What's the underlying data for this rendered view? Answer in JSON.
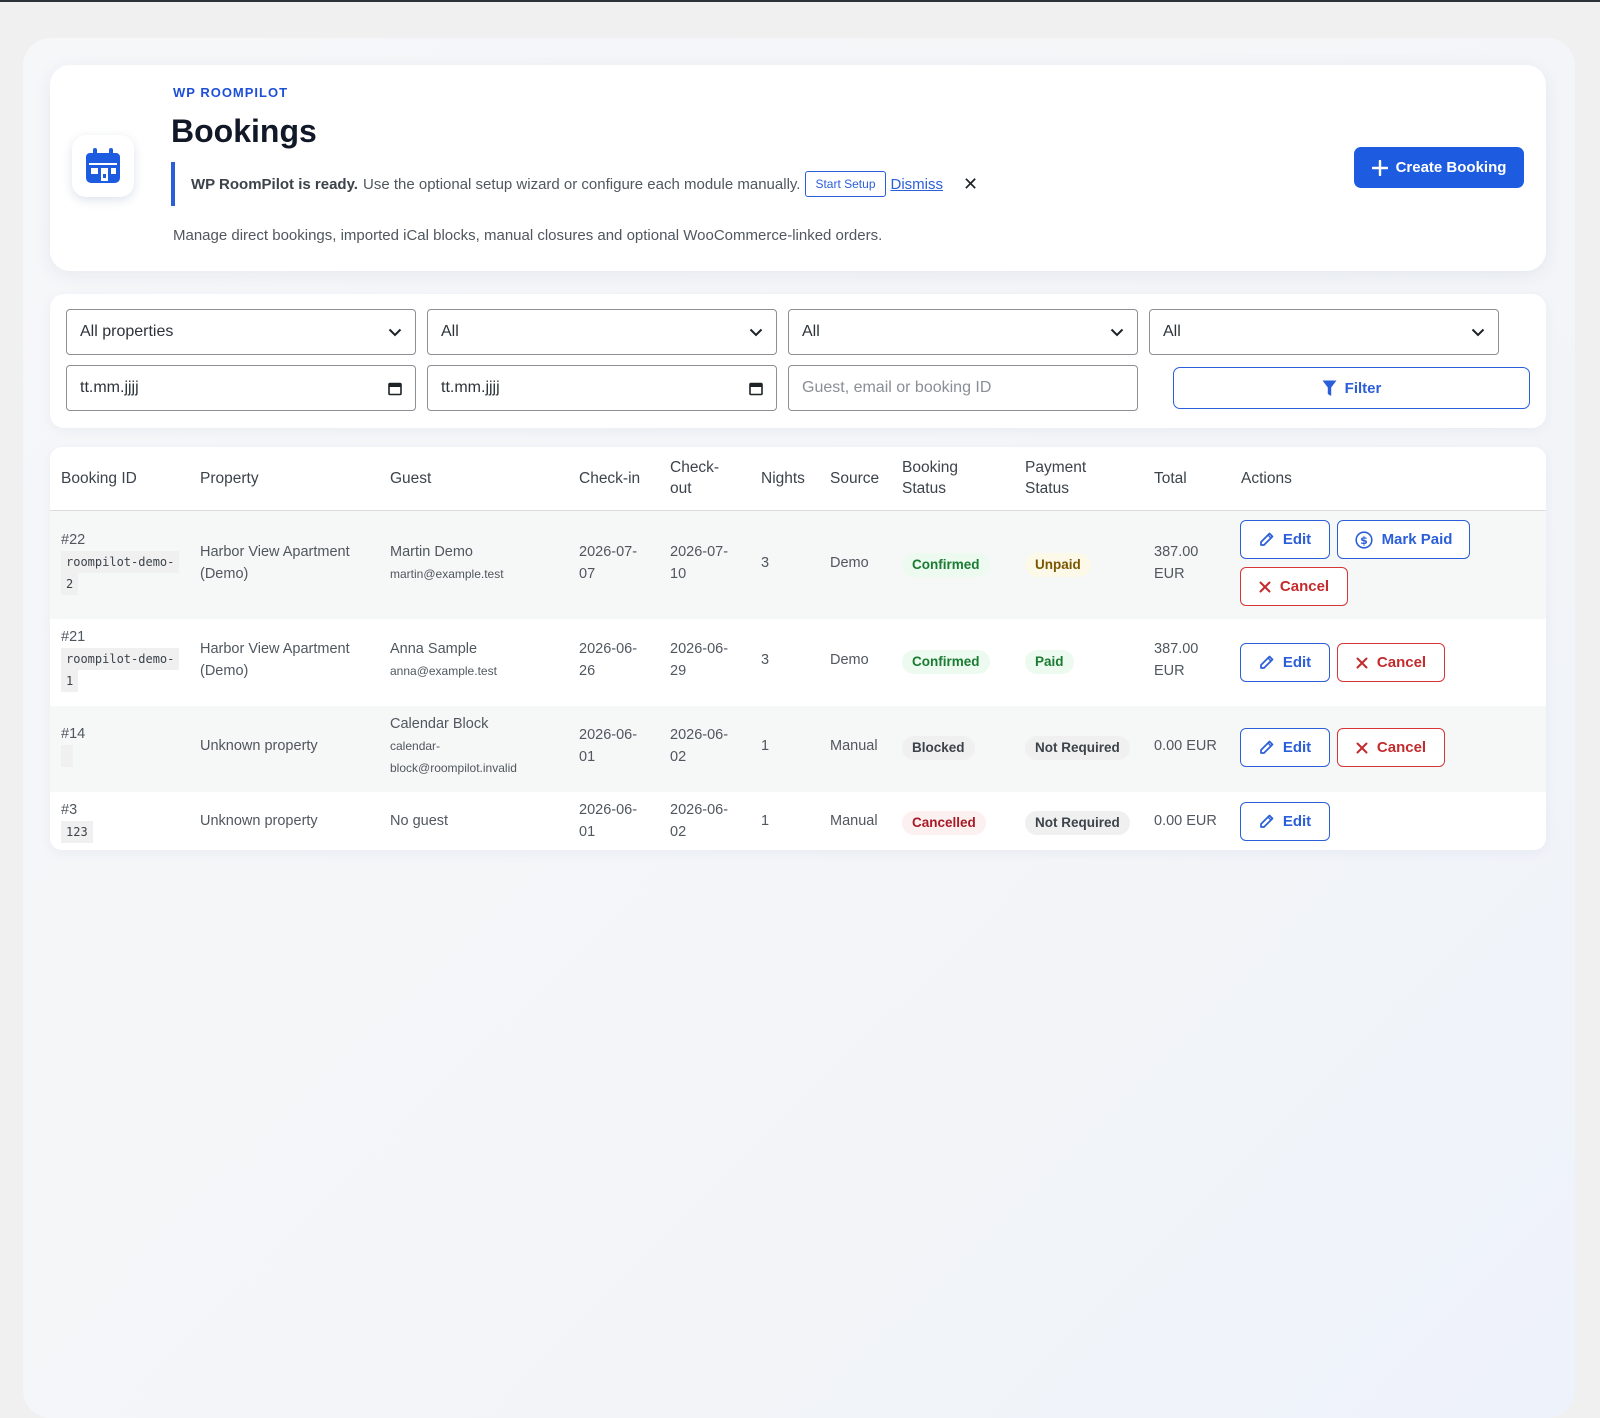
{
  "header": {
    "eyebrow": "WP ROOMPILOT",
    "title": "Bookings",
    "notice_bold": "WP RoomPilot is ready.",
    "notice_text": "Use the optional setup wizard or configure each module manually.",
    "start_setup_label": "Start Setup",
    "dismiss_label": "Dismiss",
    "close_glyph": "✕",
    "subtitle": "Manage direct bookings, imported iCal blocks, manual closures and optional WooCommerce-linked orders.",
    "create_label": "Create Booking"
  },
  "filters": {
    "property_select": "All properties",
    "select_2": "All",
    "select_3": "All",
    "select_4": "All",
    "date_from": "tt.mm.jjjj",
    "date_to": "tt.mm.jjjj",
    "search_placeholder": "Guest, email or booking ID",
    "filter_label": "Filter"
  },
  "table": {
    "headers": {
      "booking_id": "Booking ID",
      "property": "Property",
      "guest": "Guest",
      "checkin": "Check-in",
      "checkout_1": "Check-",
      "checkout_2": "out",
      "nights": "Nights",
      "source": "Source",
      "booking_status_1": "Booking",
      "booking_status_2": "Status",
      "payment_status_1": "Payment",
      "payment_status_2": "Status",
      "total": "Total",
      "actions": "Actions"
    },
    "rows": [
      {
        "id": "#22",
        "ref_1": "roompilot-demo-",
        "ref_2": "2",
        "property_1": "Harbor View Apartment",
        "property_2": "(Demo)",
        "guest": "Martin Demo",
        "email": "martin@example.test",
        "checkin_1": "2026-07-",
        "checkin_2": "07",
        "checkout_1": "2026-07-",
        "checkout_2": "10",
        "nights": "3",
        "source": "Demo",
        "booking_status": "Confirmed",
        "payment_status": "Unpaid",
        "total_1": "387.00",
        "total_2": "EUR",
        "edit": "Edit",
        "mark_paid": "Mark Paid",
        "cancel": "Cancel"
      },
      {
        "id": "#21",
        "ref_1": "roompilot-demo-",
        "ref_2": "1",
        "property_1": "Harbor View Apartment",
        "property_2": "(Demo)",
        "guest": "Anna Sample",
        "email": "anna@example.test",
        "checkin_1": "2026-06-",
        "checkin_2": "26",
        "checkout_1": "2026-06-",
        "checkout_2": "29",
        "nights": "3",
        "source": "Demo",
        "booking_status": "Confirmed",
        "payment_status": "Paid",
        "total_1": "387.00",
        "total_2": "EUR",
        "edit": "Edit",
        "cancel": "Cancel"
      },
      {
        "id": "#14",
        "ref_1": "",
        "property": "Unknown property",
        "guest": "Calendar Block",
        "email_1": "calendar-",
        "email_2": "block@roompilot.invalid",
        "checkin_1": "2026-06-",
        "checkin_2": "01",
        "checkout_1": "2026-06-",
        "checkout_2": "02",
        "nights": "1",
        "source": "Manual",
        "booking_status": "Blocked",
        "payment_status": "Not Required",
        "total": "0.00 EUR",
        "edit": "Edit",
        "cancel": "Cancel"
      },
      {
        "id": "#3",
        "ref_1": "123",
        "property": "Unknown property",
        "guest": "No guest",
        "checkin_1": "2026-06-",
        "checkin_2": "01",
        "checkout_1": "2026-06-",
        "checkout_2": "02",
        "nights": "1",
        "source": "Manual",
        "booking_status": "Cancelled",
        "payment_status": "Not Required",
        "total": "0.00 EUR",
        "edit": "Edit"
      }
    ]
  },
  "icons": {
    "app": "calendar-icon",
    "create": "plus-icon",
    "filter": "funnel-icon",
    "edit": "pencil-icon",
    "mark_paid": "dollar-circle-icon",
    "cancel": "x-icon",
    "select": "chevron-down-icon",
    "date": "calendar-small-icon"
  },
  "colors": {
    "accent": "#1d5ce0",
    "danger": "#d63638",
    "success": "#1a7b32",
    "warning": "#7a5700"
  }
}
